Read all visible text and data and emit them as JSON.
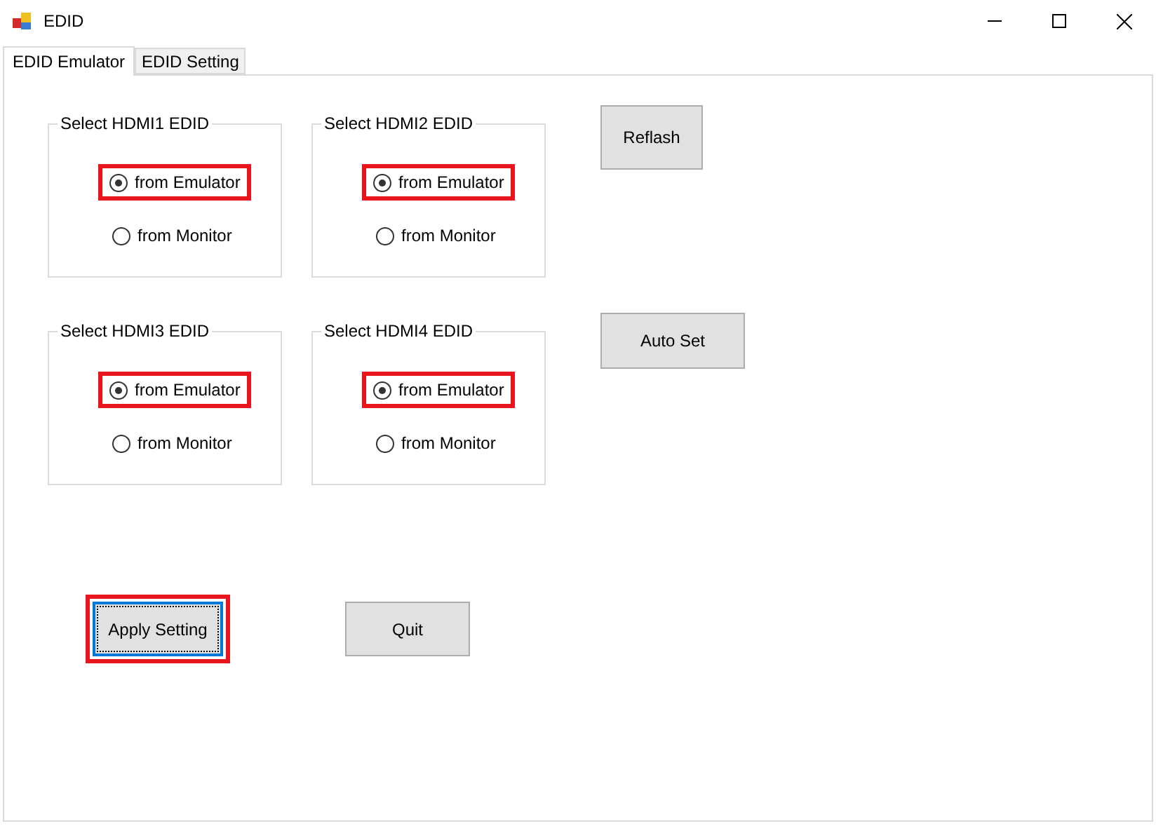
{
  "window": {
    "title": "EDID"
  },
  "tabs": [
    {
      "label": "EDID Emulator",
      "selected": true
    },
    {
      "label": "EDID Setting",
      "selected": false
    }
  ],
  "groups": [
    {
      "title": "Select HDMI1 EDID",
      "options": [
        {
          "label": "from Emulator",
          "selected": true,
          "highlighted": true
        },
        {
          "label": "from Monitor",
          "selected": false,
          "highlighted": false
        }
      ]
    },
    {
      "title": "Select HDMI2 EDID",
      "options": [
        {
          "label": "from Emulator",
          "selected": true,
          "highlighted": true
        },
        {
          "label": "from Monitor",
          "selected": false,
          "highlighted": false
        }
      ]
    },
    {
      "title": "Select HDMI3 EDID",
      "options": [
        {
          "label": "from Emulator",
          "selected": true,
          "highlighted": true
        },
        {
          "label": "from Monitor",
          "selected": false,
          "highlighted": false
        }
      ]
    },
    {
      "title": "Select HDMI4 EDID",
      "options": [
        {
          "label": "from Emulator",
          "selected": true,
          "highlighted": true
        },
        {
          "label": "from Monitor",
          "selected": false,
          "highlighted": false
        }
      ]
    }
  ],
  "side_buttons": [
    {
      "label": "Reflash"
    },
    {
      "label": "Auto Set"
    }
  ],
  "bottom_buttons": [
    {
      "label": "Apply Setting",
      "focused": true,
      "highlighted": true
    },
    {
      "label": "Quit",
      "focused": false,
      "highlighted": false
    }
  ]
}
